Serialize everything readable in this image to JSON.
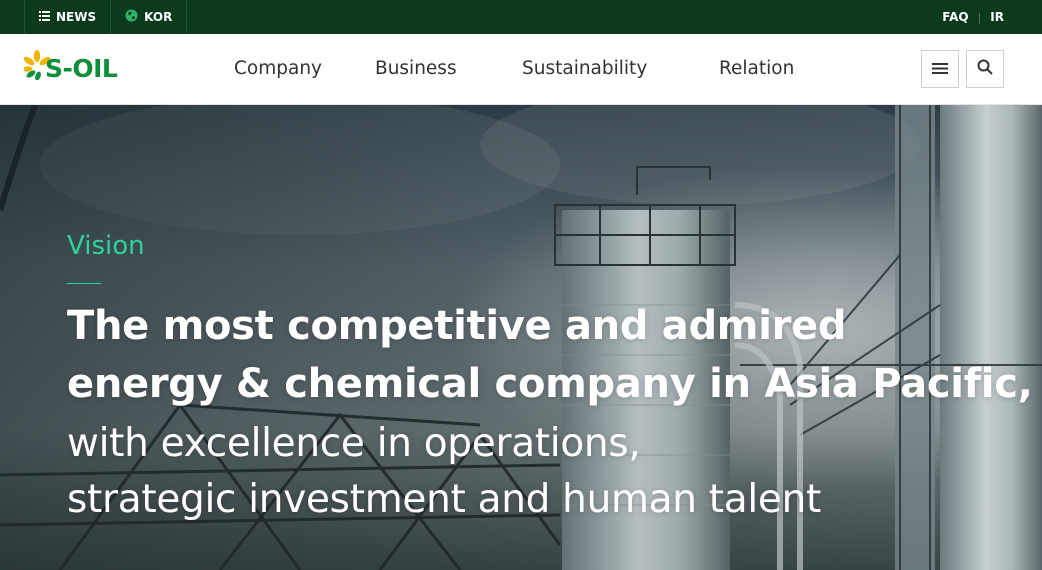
{
  "topbar": {
    "news_label": "NEWS",
    "lang_label": "KOR",
    "faq_label": "FAQ",
    "ir_label": "IR"
  },
  "header": {
    "logo_text": "S-OIL",
    "nav": [
      {
        "label": "Company"
      },
      {
        "label": "Business"
      },
      {
        "label": "Sustainability"
      },
      {
        "label": "Relation"
      }
    ],
    "menu_icon": "hamburger-menu-icon",
    "search_icon": "search-icon"
  },
  "hero": {
    "eyebrow": "Vision",
    "headline_1": "The most competitive and admired",
    "headline_2": "energy & chemical company in Asia Pacific,",
    "sub_1": "with excellence in operations,",
    "sub_2": "strategic investment and human talent"
  },
  "colors": {
    "topbar_bg": "#0b3a1d",
    "brand_green": "#0f8f3c",
    "logo_yellow": "#f5b400",
    "accent_mint": "#2fd29a"
  }
}
